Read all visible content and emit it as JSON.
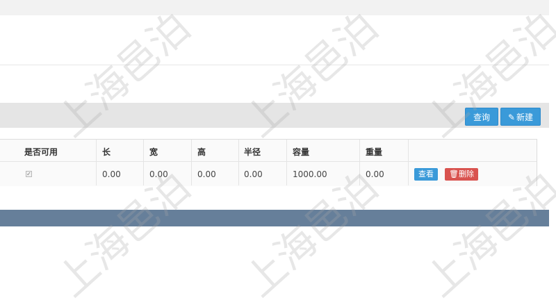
{
  "toolbar": {
    "query_label": "查询",
    "new_label": "新建",
    "new_icon": "pencil-icon"
  },
  "table": {
    "headers": [
      "是否可用",
      "长",
      "宽",
      "高",
      "半径",
      "容量",
      "重量"
    ],
    "row": {
      "enabled_checked": true,
      "values": [
        "0.00",
        "0.00",
        "0.00",
        "0.00",
        "1000.00",
        "0.00"
      ],
      "view_label": "查看",
      "delete_label": "删除",
      "delete_icon": "trash-icon"
    }
  },
  "colors": {
    "primary": "#3a9ad9",
    "danger": "#d9534f",
    "footer": "#667f9a"
  },
  "watermark": "上海邑泊"
}
